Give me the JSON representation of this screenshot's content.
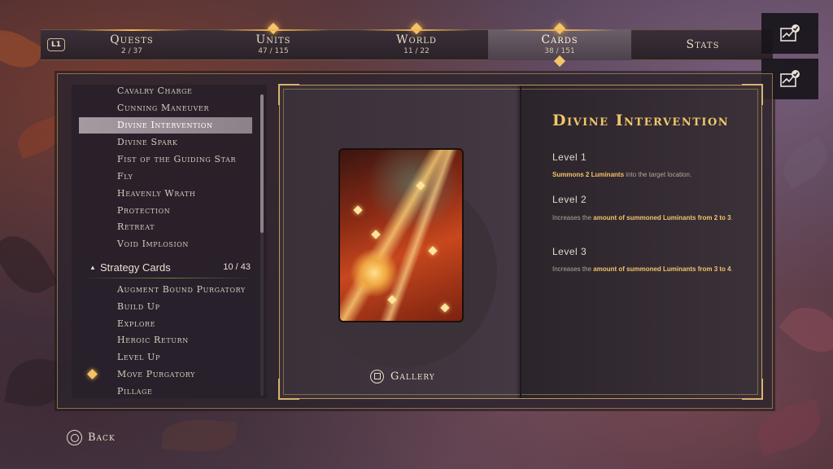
{
  "tabs": {
    "l1_label": "L1",
    "items": [
      {
        "label": "Quests",
        "count": "2 / 37"
      },
      {
        "label": "Units",
        "count": "47 / 115"
      },
      {
        "label": "World",
        "count": "11 / 22"
      },
      {
        "label": "Cards",
        "count": "38 / 151"
      },
      {
        "label": "Stats",
        "count": ""
      }
    ],
    "active_index": 3
  },
  "side_buttons": [
    {
      "icon": "chart-check-icon"
    },
    {
      "icon": "chart-check-icon"
    }
  ],
  "list": {
    "items": [
      "Cavalry Charge",
      "Cunning Maneuver",
      "Divine Intervention",
      "Divine Spark",
      "Fist of the Guiding Star",
      "Fly",
      "Heavenly Wrath",
      "Protection",
      "Retreat",
      "Void Implosion"
    ],
    "selected_index": 2,
    "section": {
      "title": "Strategy Cards",
      "count": "10 / 43"
    },
    "strategy_items": [
      "Augment Bound Purgatory",
      "Build Up",
      "Explore",
      "Heroic Return",
      "Level Up",
      "Move Purgatory",
      "Pillage"
    ],
    "marked_strategy_index": 5
  },
  "detail": {
    "title": "Divine Intervention",
    "gallery_label": "Gallery",
    "levels": [
      {
        "label": "Level 1",
        "pre": "",
        "hl": "Summons 2 Luminants",
        "post": " into the target location."
      },
      {
        "label": "Level 2",
        "pre": "Increases the ",
        "hl": "amount of summoned Luminants from 2 to 3",
        "post": "."
      },
      {
        "label": "Level 3",
        "pre": "Increases the ",
        "hl": "amount of summoned Luminants from 3 to 4",
        "post": "."
      }
    ]
  },
  "footer": {
    "back_label": "Back"
  },
  "colors": {
    "accent": "#f0c76a",
    "panel": "#2d242e",
    "gold_border": "#b79a5a"
  }
}
